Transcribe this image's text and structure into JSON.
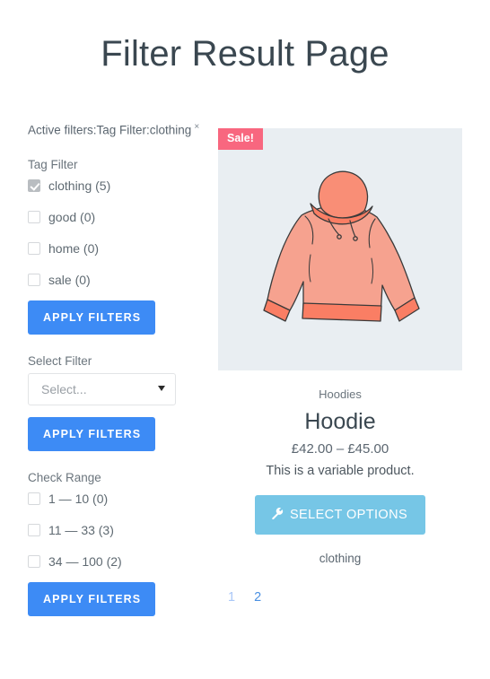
{
  "page": {
    "title": "Filter Result Page"
  },
  "sidebar": {
    "active_filters": {
      "text": "Active filters:Tag Filter:clothing",
      "remove_symbol": "×"
    },
    "tag_filter": {
      "title": "Tag Filter",
      "options": [
        {
          "label": "clothing (5)",
          "checked": true
        },
        {
          "label": "good (0)",
          "checked": false
        },
        {
          "label": "home (0)",
          "checked": false
        },
        {
          "label": "sale (0)",
          "checked": false
        }
      ],
      "apply_label": "APPLY FILTERS"
    },
    "select_filter": {
      "title": "Select Filter",
      "placeholder": "Select...",
      "arrow_icon": "chevron-down-icon",
      "apply_label": "APPLY FILTERS"
    },
    "check_range": {
      "title": "Check Range",
      "options": [
        {
          "label": "1 — 10 (0)",
          "checked": false
        },
        {
          "label": "11 — 33 (3)",
          "checked": false
        },
        {
          "label": "34 — 100 (2)",
          "checked": false
        }
      ],
      "apply_label": "APPLY FILTERS"
    }
  },
  "product": {
    "badge": "Sale!",
    "image_alt": "hoodie-illustration",
    "category": "Hoodies",
    "name": "Hoodie",
    "price": "£42.00 – £45.00",
    "description": "This is a variable product.",
    "button_label": "SELECT OPTIONS",
    "button_icon": "wrench-icon",
    "tag": "clothing"
  },
  "pagination": {
    "pages": [
      {
        "label": "1",
        "current": true
      },
      {
        "label": "2",
        "current": false
      }
    ]
  },
  "colors": {
    "accent_blue": "#3d8bf5",
    "button_light_blue": "#76c6e6",
    "sale_badge": "#f8677f",
    "image_bg": "#e9eef2",
    "title_text": "#3a4750",
    "hoodie_fill": "#f79b87"
  }
}
